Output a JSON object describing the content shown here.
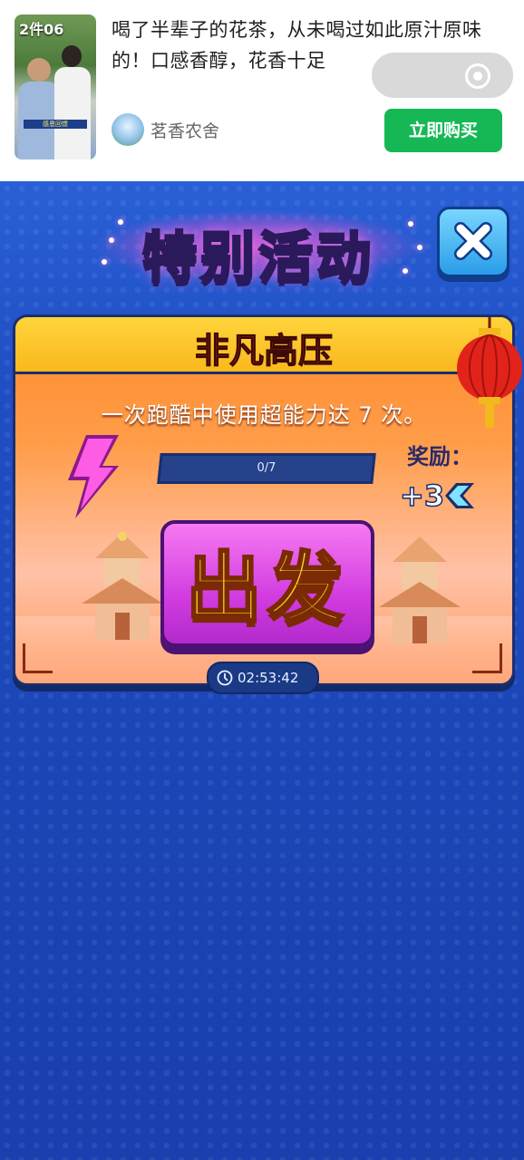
{
  "ad": {
    "thumb_tag": "2件06",
    "thumb_caption": "感恩回馈",
    "title": "喝了半辈子的花茶，从未喝过如此原汁原味的！口感香醇，花香十足",
    "brand": "茗香农舍",
    "buy_label": "立即购买"
  },
  "game": {
    "heading": "特别活动",
    "task": {
      "title": "非凡高压",
      "description": "一次跑酷中使用超能力达 7 次。",
      "progress_text": "0/7",
      "progress_fraction": 0,
      "reward_label": "奖励：",
      "reward_value": "+3"
    },
    "go_label": "出发",
    "timer": "02:53:42"
  },
  "colors": {
    "buy_green": "#16b855",
    "game_blue": "#1e46b4",
    "card_orange": "#ff8a2a",
    "go_purple": "#d23de0",
    "title_yellow": "#ffe84a"
  }
}
